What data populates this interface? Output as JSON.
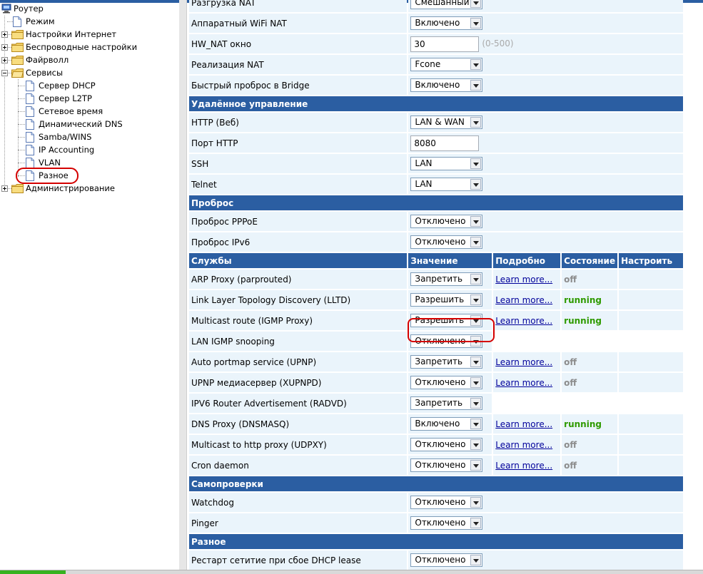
{
  "tree": {
    "root": "Роутер",
    "items": [
      {
        "label": "Режим"
      },
      {
        "label": "Настройки Интернет"
      },
      {
        "label": "Беспроводные настройки"
      },
      {
        "label": "Файрволл"
      },
      {
        "label": "Сервисы"
      },
      {
        "label": "Сервер DHCP"
      },
      {
        "label": "Сервер L2TP"
      },
      {
        "label": "Сетевое время"
      },
      {
        "label": "Динамический DNS"
      },
      {
        "label": "Samba/WINS"
      },
      {
        "label": "IP Accounting"
      },
      {
        "label": "VLAN"
      },
      {
        "label": "Разное"
      },
      {
        "label": "Администрирование"
      }
    ]
  },
  "nat": {
    "rows": [
      {
        "label": "Разгрузка NAT",
        "value": "Смешанный"
      },
      {
        "label": "Аппаратный WiFi NAT",
        "value": "Включено"
      },
      {
        "label": "HW_NAT окно",
        "value": "30",
        "hint": "(0-500)"
      },
      {
        "label": "Реализация NAT",
        "value": "Fcone"
      },
      {
        "label": "Быстрый проброс в Bridge",
        "value": "Включено"
      }
    ]
  },
  "remote": {
    "title": "Удалённое управление",
    "rows": [
      {
        "label": "HTTP (Веб)",
        "value": "LAN & WAN"
      },
      {
        "label": "Порт HTTP",
        "value": "8080"
      },
      {
        "label": "SSH",
        "value": "LAN"
      },
      {
        "label": "Telnet",
        "value": "LAN"
      }
    ]
  },
  "passthru": {
    "title": "Проброс",
    "rows": [
      {
        "label": "Проброс PPPoE",
        "value": "Отключено"
      },
      {
        "label": "Проброс IPv6",
        "value": "Отключено"
      }
    ]
  },
  "services": {
    "headers": {
      "name": "Службы",
      "value": "Значение",
      "details": "Подробно",
      "status": "Состояние",
      "configure": "Настроить"
    },
    "learn_more": "Learn more...",
    "rows": [
      {
        "label": "ARP Proxy (parprouted)",
        "value": "Запретить",
        "status": "off"
      },
      {
        "label": "Link Layer Topology Discovery (LLTD)",
        "value": "Разрешить",
        "status": "running"
      },
      {
        "label": "Multicast route (IGMP Proxy)",
        "value": "Разрешить",
        "status": "running"
      },
      {
        "label": "LAN IGMP snooping",
        "value": "Отключено"
      },
      {
        "label": "Auto portmap service (UPNP)",
        "value": "Запретить",
        "status": "off"
      },
      {
        "label": "UPNP медиасервер (XUPNPD)",
        "value": "Отключено",
        "status": "off"
      },
      {
        "label": "IPV6 Router Advertisement (RADVD)",
        "value": "Запретить"
      },
      {
        "label": "DNS Proxy (DNSMASQ)",
        "value": "Включено",
        "status": "running"
      },
      {
        "label": "Multicast to http proxy (UDPXY)",
        "value": "Отключено",
        "status": "off"
      },
      {
        "label": "Cron daemon",
        "value": "Отключено",
        "status": "off"
      }
    ]
  },
  "selfcheck": {
    "title": "Самопроверки",
    "rows": [
      {
        "label": "Watchdog",
        "value": "Отключено"
      },
      {
        "label": "Pinger",
        "value": "Отключено"
      }
    ]
  },
  "misc": {
    "title": "Разное",
    "rows": [
      {
        "label": "Рестарт сетитие при сбое DHCP lease",
        "value": "Отключено"
      }
    ]
  },
  "colors": {
    "header_bg": "#2b5ea2",
    "row_bg": "#eaf4fb",
    "running": "#2f9a00",
    "off": "#8c8c8c",
    "highlight": "#d40000"
  }
}
